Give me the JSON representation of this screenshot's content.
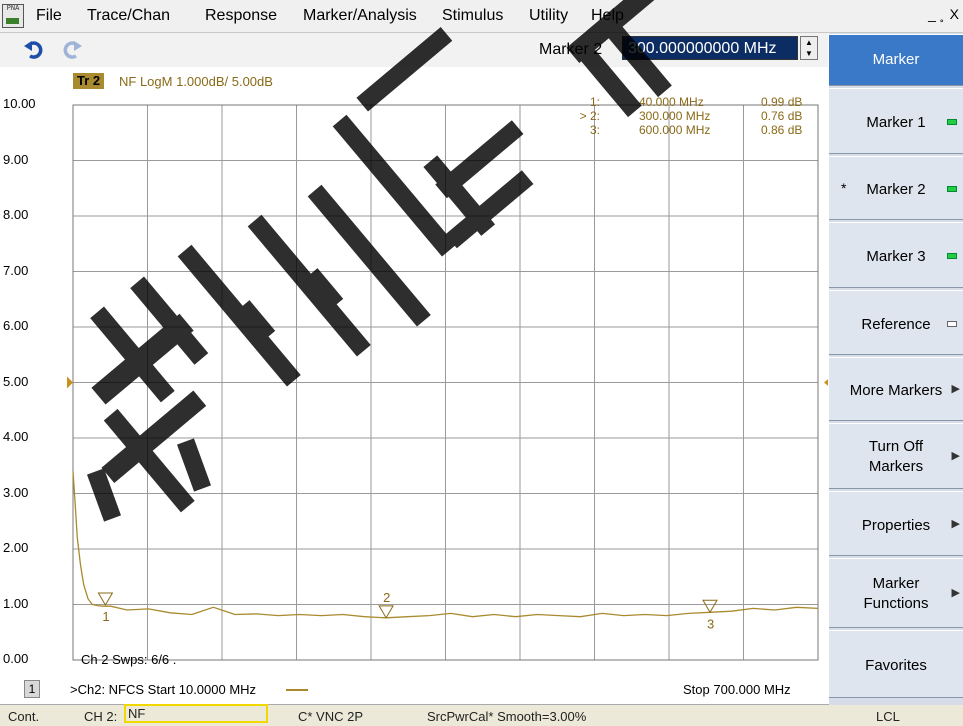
{
  "menubar": {
    "app_icon_text": "PNA",
    "items": [
      "File",
      "Trace/Chan",
      "Response",
      "Marker/Analysis",
      "Stimulus",
      "Utility",
      "Help"
    ],
    "window_controls": "_ ̥ X"
  },
  "toolbar": {
    "entry_label": "Marker 2",
    "entry_value": "300.000000000 MHz",
    "undo_icon": "undo-arrow-icon",
    "redo_icon": "redo-arrow-icon"
  },
  "trace": {
    "tag": "Tr 2",
    "info": "NF LogM 1.000dB/  5.00dB",
    "color": "#a98a2e"
  },
  "markers_table": [
    {
      "id": "1:",
      "active": false,
      "freq": "40.000 MHz",
      "val": "0.99 dB"
    },
    {
      "id": "> 2:",
      "active": true,
      "freq": "300.000 MHz",
      "val": "0.76 dB"
    },
    {
      "id": "3:",
      "active": false,
      "freq": "600.000 MHz",
      "val": "0.86 dB"
    }
  ],
  "marker_flags": [
    {
      "label": "1",
      "x_mhz": 40,
      "y_db": 0.99,
      "label_pos": "below"
    },
    {
      "label": "2",
      "x_mhz": 300,
      "y_db": 0.76,
      "label_pos": "above"
    },
    {
      "label": "3",
      "x_mhz": 600,
      "y_db": 0.86,
      "label_pos": "below"
    }
  ],
  "plot": {
    "y_ticks": [
      "10.00",
      "9.00",
      "8.00",
      "7.00",
      "6.00",
      "5.00",
      "4.00",
      "3.00",
      "2.00",
      "1.00",
      "0.00"
    ],
    "reference_value": 5.0,
    "status_line": "Ch 2  Swps: 6/6 ."
  },
  "chart_data": {
    "type": "line",
    "title": "",
    "xlabel": "",
    "ylabel": "",
    "xlim": [
      10,
      700
    ],
    "ylim": [
      0,
      10
    ],
    "grid": true,
    "series": [
      {
        "name": "Tr 2",
        "x": [
          10,
          12,
          14,
          17,
          20,
          24,
          28,
          33,
          38,
          45,
          60,
          80,
          100,
          120,
          140,
          160,
          180,
          200,
          220,
          240,
          260,
          280,
          300,
          320,
          340,
          360,
          380,
          400,
          420,
          440,
          460,
          480,
          500,
          520,
          540,
          560,
          580,
          600,
          620,
          640,
          660,
          680,
          700
        ],
        "y": [
          3.4,
          2.8,
          2.2,
          1.7,
          1.35,
          1.1,
          1.0,
          0.98,
          0.97,
          0.97,
          0.9,
          0.92,
          0.85,
          0.82,
          0.95,
          0.82,
          0.83,
          0.8,
          0.82,
          0.8,
          0.82,
          0.78,
          0.76,
          0.78,
          0.8,
          0.84,
          0.78,
          0.82,
          0.78,
          0.82,
          0.8,
          0.78,
          0.84,
          0.8,
          0.82,
          0.8,
          0.84,
          0.86,
          0.88,
          0.93,
          0.9,
          0.95,
          0.93
        ]
      }
    ]
  },
  "footer": {
    "channel_num": "1",
    "start": ">Ch2: NFCS   Start  10.0000 MHz",
    "stop": "Stop  700.000 MHz"
  },
  "statusbar": {
    "mode": "Cont.",
    "channel": "CH 2:",
    "meas": "NF",
    "cal": "C* VNC  2P",
    "src": "SrcPwrCal* Smooth=3.00%",
    "lcl": "LCL"
  },
  "softkeys": {
    "title": "Marker",
    "items": [
      {
        "label": "Marker 1",
        "led": "on",
        "selected": false,
        "arrow": false
      },
      {
        "label": "Marker 2",
        "led": "on",
        "selected": true,
        "arrow": false
      },
      {
        "label": "Marker 3",
        "led": "on",
        "selected": false,
        "arrow": false
      },
      {
        "label": "Reference",
        "led": "off",
        "selected": false,
        "arrow": false
      },
      {
        "label": "More Markers",
        "led": "",
        "selected": false,
        "arrow": true
      },
      {
        "label": "Turn Off\nMarkers",
        "led": "",
        "selected": false,
        "arrow": true
      },
      {
        "label": "Properties",
        "led": "",
        "selected": false,
        "arrow": true
      },
      {
        "label": "Marker\nFunctions",
        "led": "",
        "selected": false,
        "arrow": true
      },
      {
        "label": "Favorites",
        "led": "",
        "selected": false,
        "arrow": false
      }
    ],
    "selected_mark": "*"
  },
  "watermark": {
    "text": "苏州启道"
  }
}
